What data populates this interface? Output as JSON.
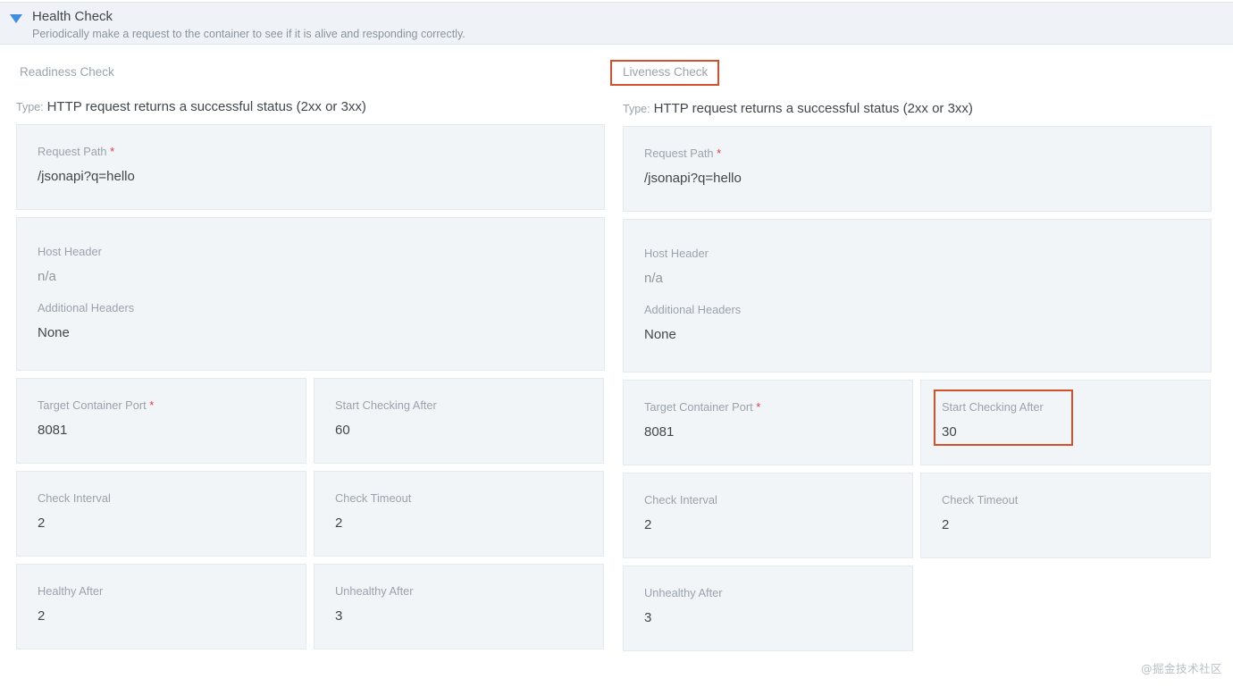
{
  "header": {
    "title": "Health Check",
    "subtitle": "Periodically make a request to the container to see if it is alive and responding correctly.",
    "collapse_icon": "chevron-down-icon"
  },
  "accent": {
    "annotation_red": "#d4502a",
    "required_red": "#e0394a",
    "arrow_blue": "#3f8ddc",
    "card_bg": "#f2f5f8",
    "header_bg": "#eff3f7"
  },
  "readiness": {
    "label": "Readiness Check",
    "highlighted": false,
    "type_key": "Type:",
    "type_value": "HTTP request returns a successful status (2xx or 3xx)",
    "request_path": {
      "label": "Request Path",
      "required": "*",
      "value": "/jsonapi?q=hello"
    },
    "host_header": {
      "label": "Host Header",
      "value": "n/a"
    },
    "additional_headers": {
      "label": "Additional Headers",
      "value": "None"
    },
    "target_container_port": {
      "label": "Target Container Port",
      "required": "*",
      "value": "8081"
    },
    "start_checking_after": {
      "label": "Start Checking After",
      "value": "60",
      "highlighted": false
    },
    "check_interval": {
      "label": "Check Interval",
      "value": "2"
    },
    "check_timeout": {
      "label": "Check Timeout",
      "value": "2"
    },
    "healthy_after": {
      "label": "Healthy After",
      "value": "2"
    },
    "unhealthy_after": {
      "label": "Unhealthy After",
      "value": "3"
    }
  },
  "liveness": {
    "label": "Liveness Check",
    "highlighted": true,
    "type_key": "Type:",
    "type_value": "HTTP request returns a successful status (2xx or 3xx)",
    "request_path": {
      "label": "Request Path",
      "required": "*",
      "value": "/jsonapi?q=hello"
    },
    "host_header": {
      "label": "Host Header",
      "value": "n/a"
    },
    "additional_headers": {
      "label": "Additional Headers",
      "value": "None"
    },
    "target_container_port": {
      "label": "Target Container Port",
      "required": "*",
      "value": "8081"
    },
    "start_checking_after": {
      "label": "Start Checking After",
      "value": "30",
      "highlighted": true
    },
    "check_interval": {
      "label": "Check Interval",
      "value": "2"
    },
    "check_timeout": {
      "label": "Check Timeout",
      "value": "2"
    },
    "unhealthy_after": {
      "label": "Unhealthy After",
      "value": "3"
    }
  },
  "watermark": "@掘金技术社区"
}
